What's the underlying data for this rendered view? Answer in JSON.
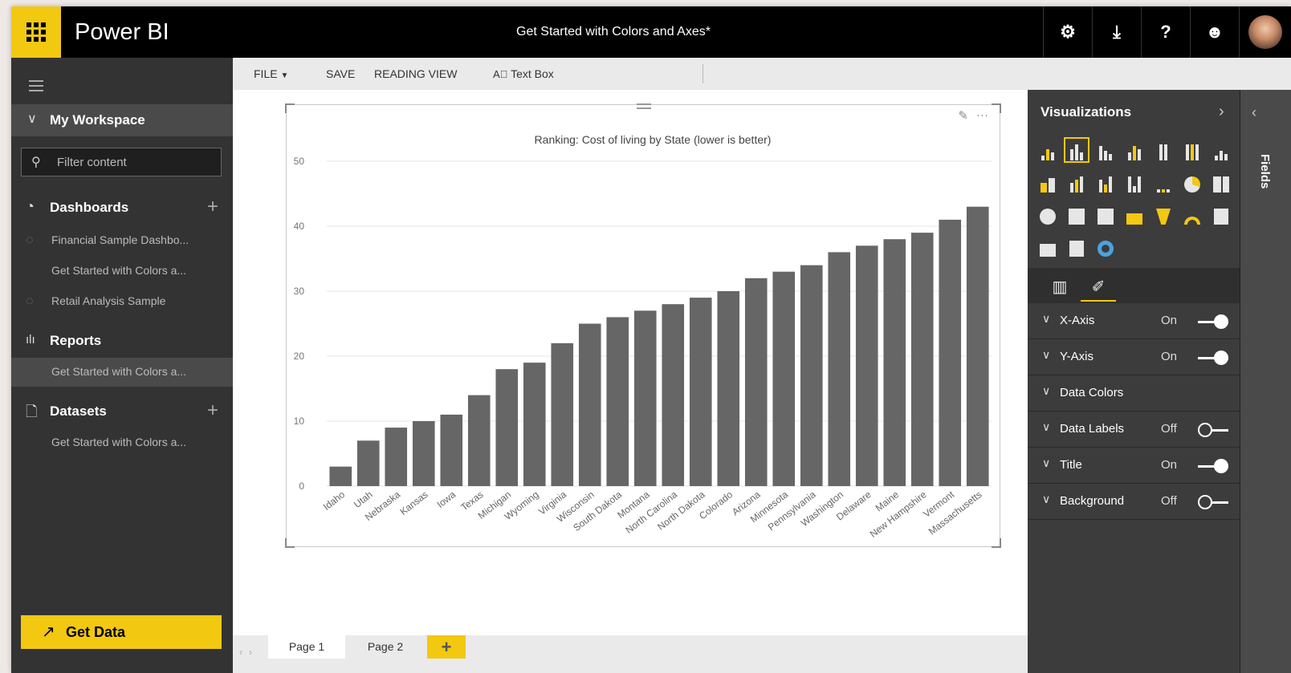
{
  "app": {
    "brand": "Power BI",
    "doc_title": "Get Started with Colors and Axes*"
  },
  "top_icons": [
    "gear-icon",
    "download-icon",
    "help-icon",
    "smiley-icon"
  ],
  "nav": {
    "workspace": "My Workspace",
    "filter_placeholder": "Filter content",
    "dashboards": {
      "label": "Dashboards",
      "items": [
        "Financial Sample Dashbo...",
        "Get Started with Colors a...",
        "Retail Analysis Sample"
      ]
    },
    "reports": {
      "label": "Reports",
      "items": [
        "Get Started with Colors a..."
      ]
    },
    "datasets": {
      "label": "Datasets",
      "items": [
        "Get Started with Colors a..."
      ]
    },
    "get_data": "Get Data"
  },
  "toolbar": {
    "file": "FILE",
    "save": "SAVE",
    "reading_view": "READING VIEW",
    "text_box": "Text Box"
  },
  "pages": [
    "Page 1",
    "Page 2"
  ],
  "visualizations": {
    "title": "Visualizations",
    "format_rows": [
      {
        "label": "X-Axis",
        "state": "On"
      },
      {
        "label": "Y-Axis",
        "state": "On"
      },
      {
        "label": "Data Colors",
        "state": ""
      },
      {
        "label": "Data Labels",
        "state": "Off"
      },
      {
        "label": "Title",
        "state": "On"
      },
      {
        "label": "Background",
        "state": "Off"
      }
    ]
  },
  "fields_label": "Fields",
  "colors": {
    "accent": "#f2c811",
    "bar": "#666666"
  },
  "chart_data": {
    "type": "bar",
    "title": "Ranking: Cost of living by State (lower is better)",
    "xlabel": "",
    "ylabel": "",
    "ylim": [
      0,
      50
    ],
    "yticks": [
      0,
      10,
      20,
      30,
      40,
      50
    ],
    "grid": true,
    "categories": [
      "Idaho",
      "Utah",
      "Nebraska",
      "Kansas",
      "Iowa",
      "Texas",
      "Michigan",
      "Wyoming",
      "Virginia",
      "Wisconsin",
      "South Dakota",
      "Montana",
      "North Carolina",
      "North Dakota",
      "Colorado",
      "Arizona",
      "Minnesota",
      "Pennsylvania",
      "Washington",
      "Delaware",
      "Maine",
      "New Hampshire",
      "Vermont",
      "Massachusetts"
    ],
    "values": [
      3,
      7,
      9,
      10,
      11,
      14,
      18,
      19,
      22,
      25,
      26,
      27,
      28,
      29,
      30,
      32,
      33,
      34,
      36,
      37,
      38,
      39,
      41,
      43
    ]
  }
}
